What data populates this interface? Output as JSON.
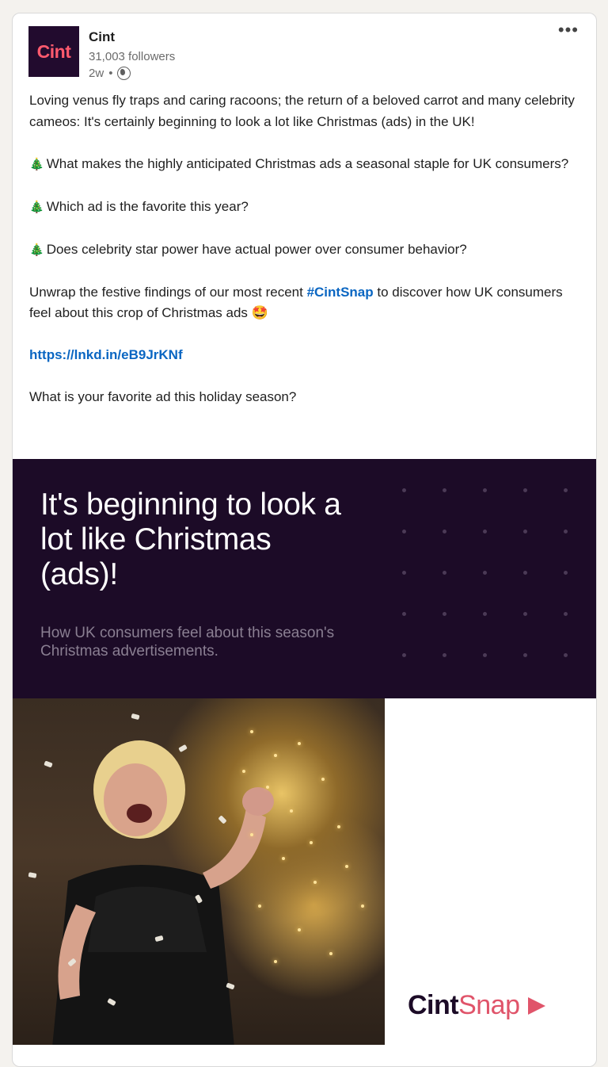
{
  "post": {
    "author": "Cint",
    "logo_text": "Cint",
    "followers": "31,003 followers",
    "time": "2w",
    "separator": "•",
    "more": "•••"
  },
  "content": {
    "p1": "Loving venus fly traps and caring racoons; the return of a beloved carrot and many celebrity cameos: It's certainly beginning to look a lot like Christmas (ads) in the UK!",
    "tree_emoji": "🎄",
    "q1": "What makes the highly anticipated Christmas ads a seasonal staple for UK consumers?",
    "q2": "Which ad is the favorite this year?",
    "q3": "Does celebrity star power have actual power over consumer behavior?",
    "p2_start": "Unwrap the festive findings of our most recent ",
    "hashtag": "#CintSnap",
    "p2_end": " to discover how UK consumers feel about this crop of Christmas ads ",
    "starstruck_emoji": "🤩",
    "link": "https://lnkd.in/eB9JrKNf",
    "p3": "What is your favorite ad this holiday season?"
  },
  "image": {
    "title": "It's beginning to look a lot like Christmas (ads)!",
    "subtitle": "How UK consumers feel about this season's Christmas advertisements.",
    "brand_a": "Cint",
    "brand_b": "Snap"
  }
}
